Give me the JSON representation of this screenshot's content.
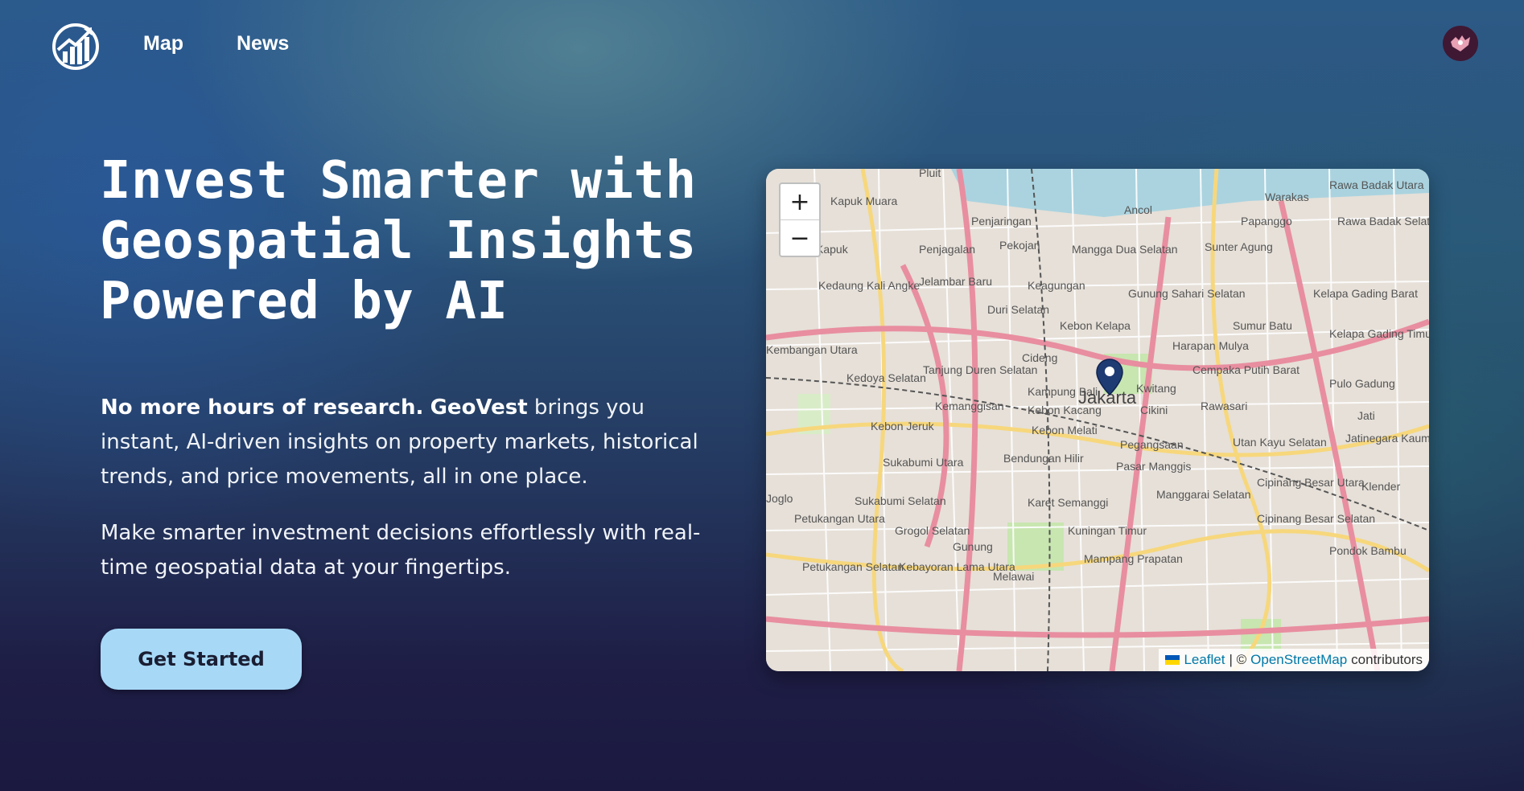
{
  "nav": {
    "links": [
      "Map",
      "News"
    ],
    "logo_icon": "chart-growth-logo-icon",
    "avatar_icon": "user-avatar-icon"
  },
  "hero": {
    "title_lines": [
      "Invest Smarter with",
      "Geospatial Insights",
      "Powered by AI"
    ],
    "para1_bold1": "No more hours of research.",
    "para1_bold2": "GeoVest",
    "para1_rest": " brings you instant, AI-driven insights on property markets, historical trends, and price movements, all in one place.",
    "para2": "Make smarter investment decisions effortlessly with real-time geospatial data at your fingertips.",
    "cta_label": "Get Started"
  },
  "map": {
    "zoom_in": "+",
    "zoom_out": "−",
    "marker_label": "Jakarta",
    "attribution": {
      "leaflet": "Leaflet",
      "separator": "| ©",
      "osm": "OpenStreetMap",
      "suffix": "contributors"
    },
    "places": [
      "Pluit",
      "Kapuk Muara",
      "Penjaringan",
      "Ancol",
      "Warakas",
      "Rawa Badak Utara",
      "Papanggo",
      "Rawa Badak Selatan",
      "Kapuk",
      "Penjagalan",
      "Pekojan",
      "Mangga Dua Selatan",
      "Sunter Agung",
      "Kedaung Kali Angke",
      "Jelambar Baru",
      "Keagungan",
      "Gunung Sahari Selatan",
      "Kelapa Gading Barat",
      "Duri Selatan",
      "Sumur Batu",
      "Kebon Kelapa",
      "Harapan Mulya",
      "Kelapa Gading Timur",
      "Kembangan Utara",
      "Tanjung Duren Selatan",
      "Cideng",
      "Cempaka Putih Barat",
      "Kedoya Selatan",
      "Kampung Bali",
      "Kwitang",
      "Pulo Gadung",
      "Kemanggisan",
      "Kebon Kacang",
      "Cikini",
      "Rawasari",
      "Kebon Jeruk",
      "Kebon Melati",
      "Jati",
      "Pegangsaan",
      "Utan Kayu Selatan",
      "Jatinegara Kaum",
      "Bendungan Hilir",
      "Sukabumi Utara",
      "Pasar Manggis",
      "Cipinang Besar Utara",
      "Klender",
      "Joglo",
      "Sukabumi Selatan",
      "Karet Semanggi",
      "Manggarai Selatan",
      "Petukangan Utara",
      "Grogol Selatan",
      "Kuningan Timur",
      "Cipinang Besar Selatan",
      "Gunung",
      "Pondok Bambu",
      "Petukangan Selatan",
      "Kebayoran Lama Utara",
      "Melawai",
      "Mampang Prapatan",
      "Kebon Jeruk"
    ]
  },
  "colors": {
    "cta_bg": "#a7d9f7",
    "marker": "#1f3b73",
    "link": "#0078a8"
  }
}
